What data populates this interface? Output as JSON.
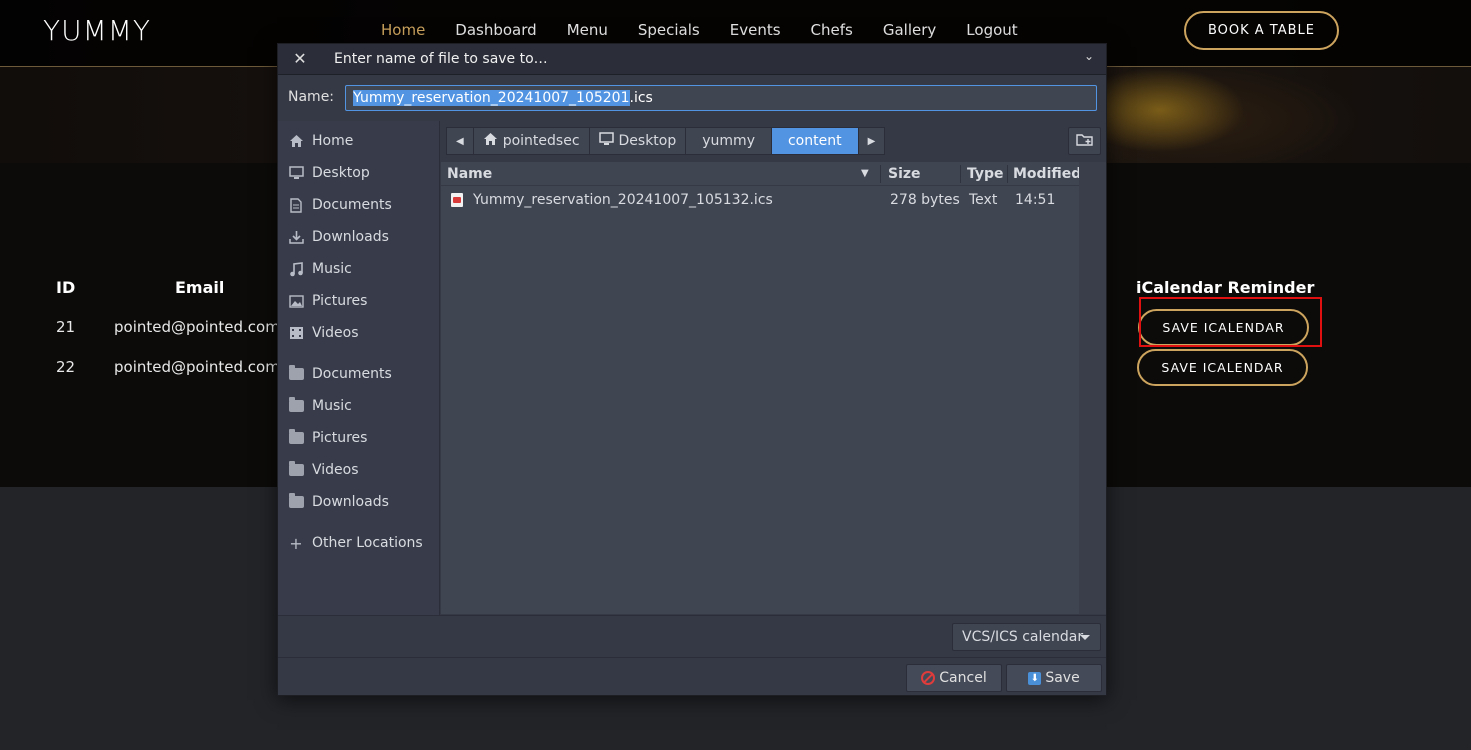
{
  "site": {
    "logo": "YUMMY",
    "nav": [
      "Home",
      "Dashboard",
      "Menu",
      "Specials",
      "Events",
      "Chefs",
      "Gallery",
      "Logout"
    ],
    "book_button": "BOOK A TABLE",
    "table": {
      "headers": {
        "id": "ID",
        "email": "Email",
        "reminder": "iCalendar Reminder"
      },
      "rows": [
        {
          "id": "21",
          "email": "pointed@pointed.com",
          "button": "SAVE ICALENDAR"
        },
        {
          "id": "22",
          "email": "pointed@pointed.com",
          "button": "SAVE ICALENDAR"
        }
      ]
    }
  },
  "dialog": {
    "title": "Enter name of file to save to…",
    "name_label": "Name:",
    "filename_selected": "Yummy_reservation_20241007_105201",
    "filename_ext": ".ics",
    "places": [
      {
        "label": "Home",
        "icon": "home-icon"
      },
      {
        "label": "Desktop",
        "icon": "desktop-icon"
      },
      {
        "label": "Documents",
        "icon": "documents-icon"
      },
      {
        "label": "Downloads",
        "icon": "downloads-icon"
      },
      {
        "label": "Music",
        "icon": "music-icon"
      },
      {
        "label": "Pictures",
        "icon": "pictures-icon"
      },
      {
        "label": "Videos",
        "icon": "videos-icon"
      }
    ],
    "bookmarks": [
      "Documents",
      "Music",
      "Pictures",
      "Videos",
      "Downloads"
    ],
    "other_locations": "Other Locations",
    "path": [
      "pointedsec",
      "Desktop",
      "yummy",
      "content"
    ],
    "columns": {
      "name": "Name",
      "size": "Size",
      "type": "Type",
      "modified": "Modified"
    },
    "files": [
      {
        "name": "Yummy_reservation_20241007_105132.ics",
        "size": "278 bytes",
        "type": "Text",
        "modified": "14:51"
      }
    ],
    "filter": "VCS/ICS calendar",
    "cancel": "Cancel",
    "save": "Save"
  },
  "colors": {
    "accent_gold": "#cda45e",
    "selection_blue": "#5294e2",
    "highlight_red": "#e01010"
  }
}
